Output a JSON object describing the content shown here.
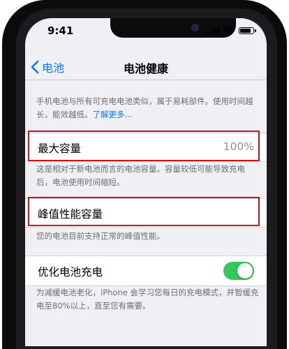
{
  "status_bar": {
    "time": "9:41",
    "icons": [
      "cellular-signal-icon",
      "wifi-icon",
      "battery-icon"
    ]
  },
  "nav": {
    "back_label": "电池",
    "title": "电池健康"
  },
  "intro": {
    "text": "手机电池与所有可充电电池类似，属于易耗部件。使用时间越长，能效越低。",
    "link": "了解更多..."
  },
  "max_capacity": {
    "label": "最大容量",
    "value": "100%",
    "description": "这是相对于新电池而言的电池容量。容量较低可能导致充电后，电池使用时间缩短。"
  },
  "peak_performance": {
    "label": "峰值性能容量",
    "description": "您的电池目前支持正常的峰值性能。"
  },
  "optimized_charging": {
    "label": "优化电池充电",
    "enabled": true,
    "description": "为减缓电池老化，iPhone 会学习您每日的充电模式，并暂缓充电至80%以上，直至您有需要。"
  },
  "colors": {
    "accent": "#0a7aff",
    "toggle_on": "#34c759",
    "highlight": "#d10f16",
    "background": "#efeff4"
  }
}
